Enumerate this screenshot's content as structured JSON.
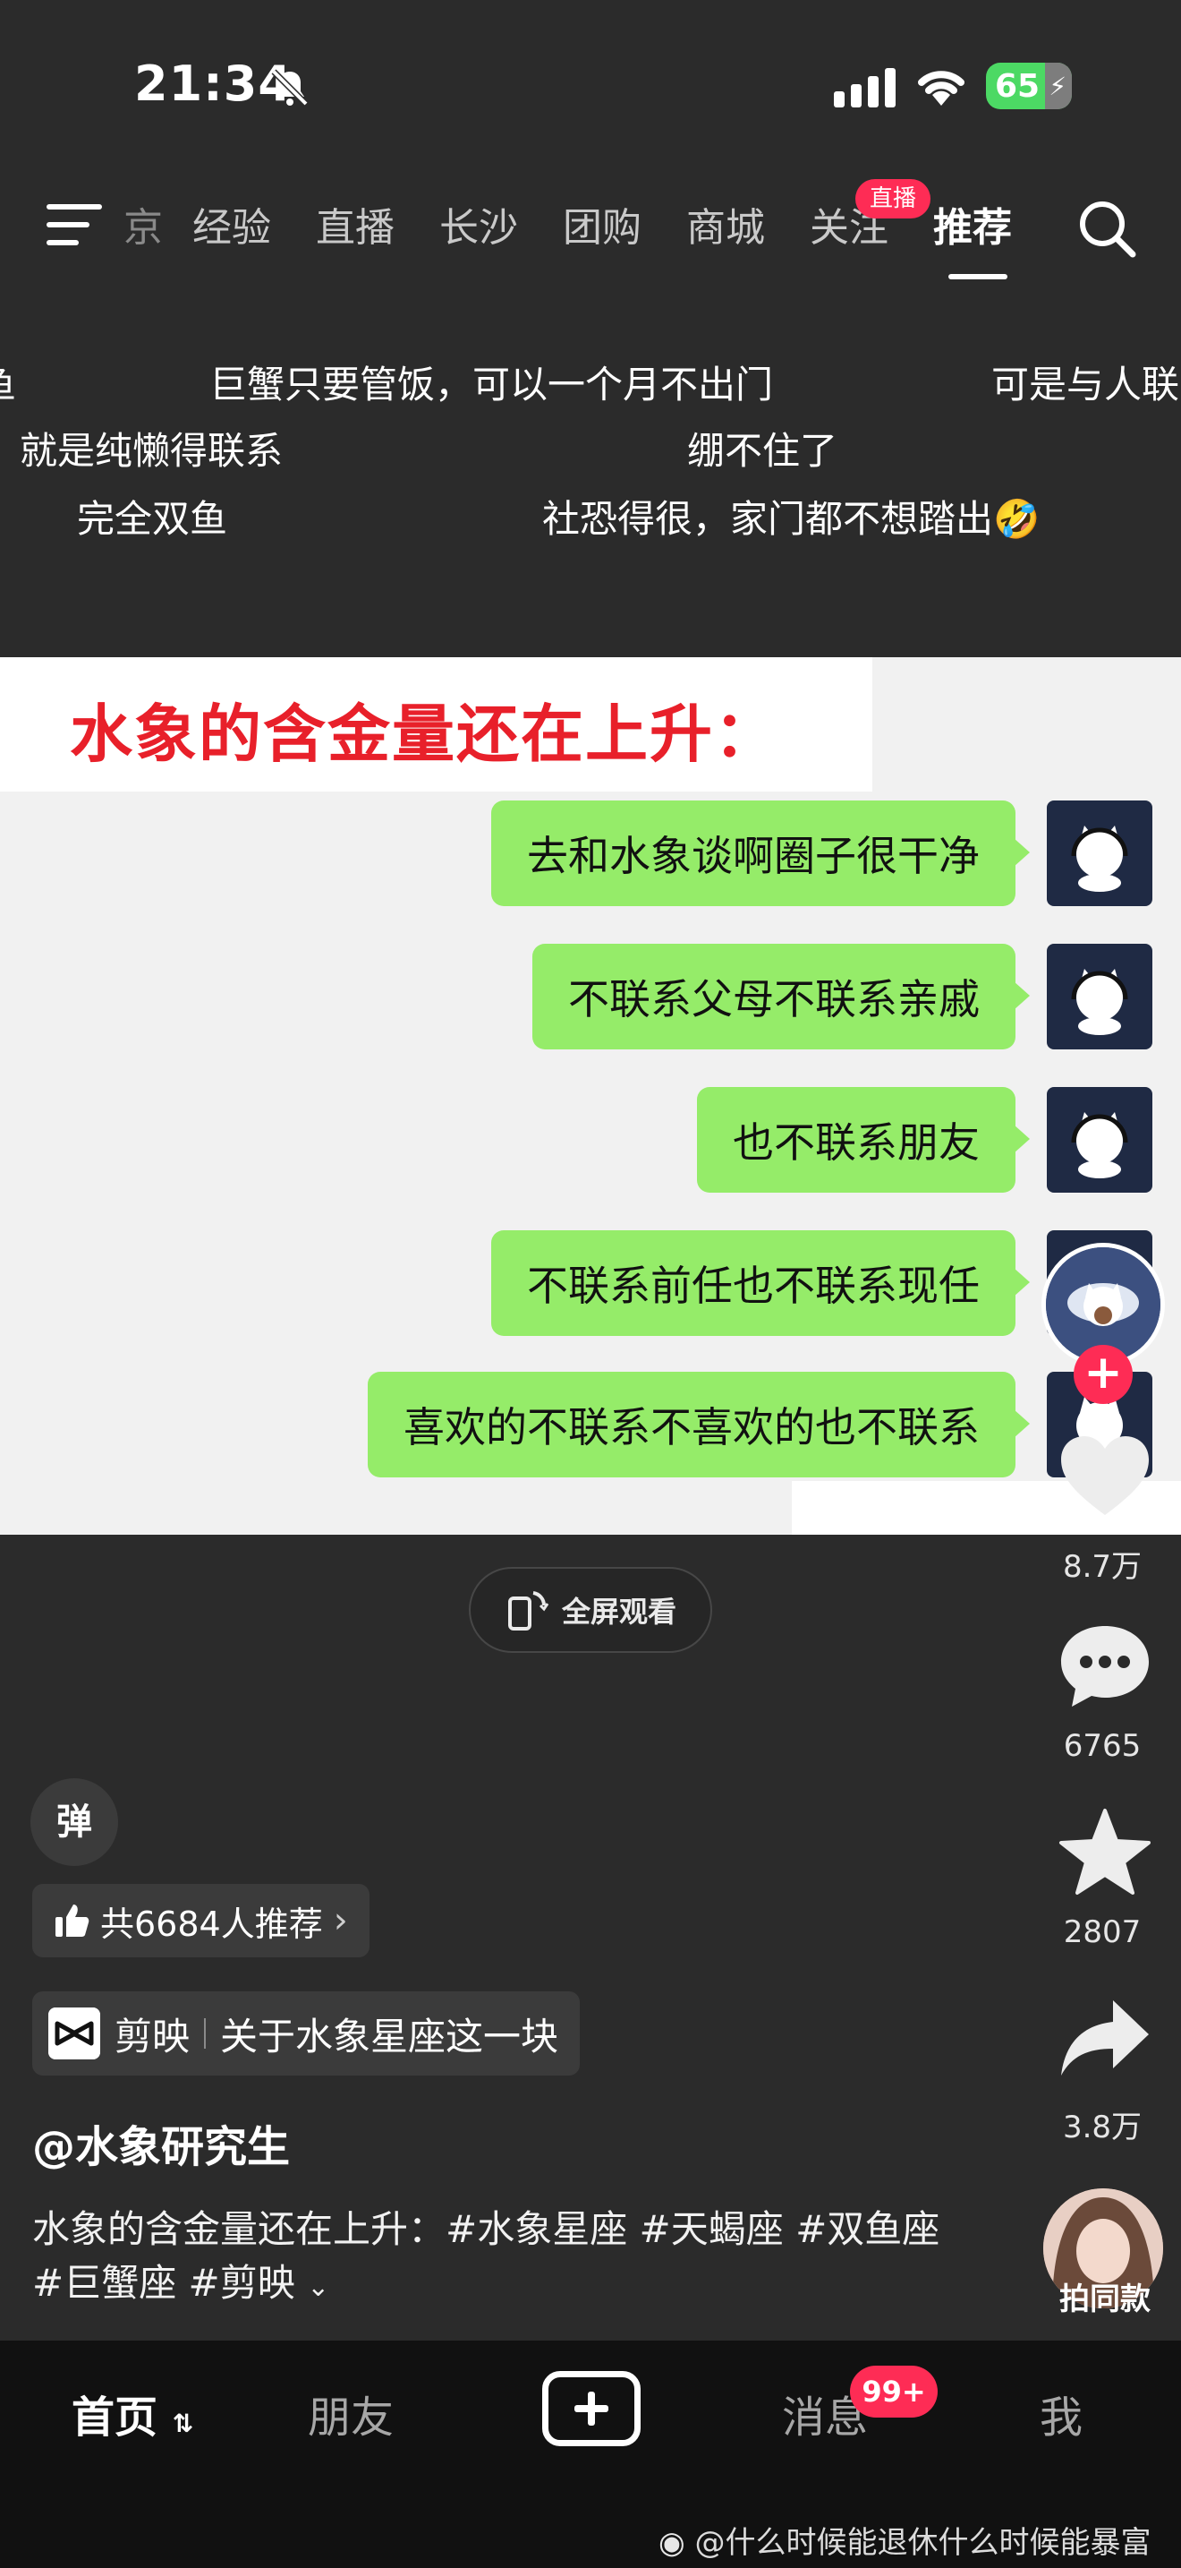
{
  "status_bar": {
    "time": "21:34",
    "battery": "65"
  },
  "top_nav": {
    "tabs": [
      "京",
      "经验",
      "直播",
      "长沙",
      "团购",
      "商城",
      "关注",
      "推荐"
    ],
    "active_tab": "推荐",
    "live_badge": "直播"
  },
  "danmaku": [
    "鱼",
    "巨蟹只要管饭，可以一个月不出门",
    "可是与人联",
    "，就是纯懒得联系",
    "绷不住了",
    "完全双鱼",
    "社恐得很，家门都不想踏出🤣"
  ],
  "video": {
    "title": "水象的含金量还在上升：",
    "messages": [
      "去和水象谈啊圈子很干净",
      "不联系父母不联系亲戚",
      "也不联系朋友",
      "不联系前任也不联系现任",
      "喜欢的不联系不喜欢的也不联系"
    ]
  },
  "fullscreen_label": "全屏观看",
  "actions": {
    "likes": "8.7万",
    "comments": "6765",
    "favorites": "2807",
    "shares": "3.8万",
    "same_style": "拍同款"
  },
  "danmu_toggle": "弹",
  "recommend": "共6684人推荐",
  "app_chip": {
    "app": "剪映",
    "topic": "关于水象星座这一块"
  },
  "author": "@水象研究生",
  "description": "水象的含金量还在上升：#水象星座 #天蝎座 #双鱼座 #巨蟹座 #剪映",
  "bottom_tabs": {
    "home": "首页",
    "friends": "朋友",
    "messages": "消息",
    "me": "我",
    "msg_badge": "99+"
  },
  "watermark": "@什么时候能退休什么时候能暴富",
  "colors": {
    "accent": "#fe2c55",
    "bubble": "#95ec69",
    "title_red": "#e8202a"
  }
}
